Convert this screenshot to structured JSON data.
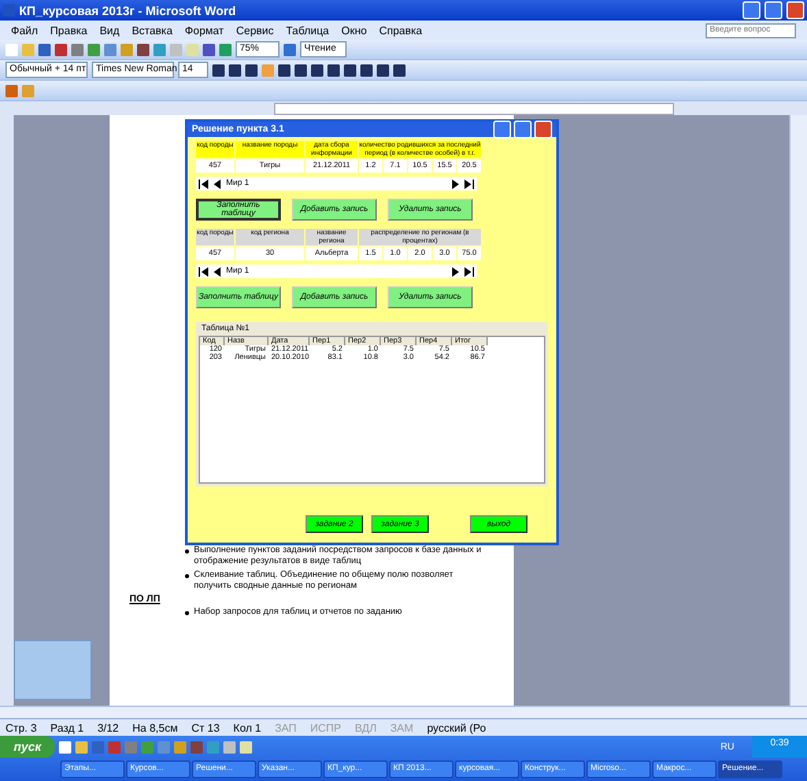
{
  "window": {
    "title": "КП_курсовая 2013г - Microsoft Word"
  },
  "menu": [
    "Файл",
    "Правка",
    "Вид",
    "Вставка",
    "Формат",
    "Сервис",
    "Таблица",
    "Окно",
    "Справка"
  ],
  "help_search": {
    "placeholder": "Введите вопрос"
  },
  "toolbar": {
    "zoom": "75%",
    "reading": "Чтение",
    "style": "Обычный + 14 пт",
    "font": "Times New Roman",
    "size": "14"
  },
  "dialog": {
    "title": "Решение пункта 3.1",
    "section1": {
      "labels": [
        "код породы",
        "название породы",
        "дата сбора информации",
        "количество родившихся за последний период (в количестве особей) в т.г."
      ],
      "values": [
        "457",
        "Тигры",
        "21.12.2011",
        "1.2",
        "7.1",
        "10.5",
        "15.5",
        "20.5"
      ],
      "record": "Мир 1",
      "buttons": [
        {
          "label": "Заполнить таблицу",
          "focused": true
        },
        {
          "label": "Добавить запись",
          "focused": false
        },
        {
          "label": "Удалить запись",
          "focused": false
        }
      ]
    },
    "section2": {
      "labels": [
        "код породы",
        "код региона",
        "название региона",
        "распределение по регионам (в процентах)"
      ],
      "values": [
        "457",
        "30",
        "Альберта",
        "1.5",
        "1.0",
        "2.0",
        "3.0",
        "75.0"
      ],
      "record": "Мир 1",
      "buttons": [
        {
          "label": "Заполнить таблицу",
          "focused": false
        },
        {
          "label": "Добавить запись",
          "focused": false
        },
        {
          "label": "Удалить запись",
          "focused": false
        }
      ]
    },
    "table": {
      "title": "Таблица №1",
      "columns": [
        "Код",
        "Назв",
        "Дата",
        "Пер1",
        "Пер2",
        "Пер3",
        "Пер4",
        "Итог"
      ],
      "rows": [
        [
          "120",
          "Тигры",
          "21.12.2011",
          "5.2",
          "1.0",
          "7.5",
          "7.5",
          "10.5"
        ],
        [
          "203",
          "Ленивцы",
          "20.10.2010",
          "83.1",
          "10.8",
          "3.0",
          "54.2",
          "86.7"
        ]
      ]
    },
    "footer_buttons": [
      "задание 2",
      "задание 3",
      "выход"
    ]
  },
  "document": {
    "bullets": [
      "Выполнение пунктов заданий посредством запросов к базе данных и отображение результатов в виде таблиц",
      "Склеивание таблиц. Объединение по общему полю позволяет получить сводные данные по регионам"
    ],
    "heading": "ПО ЛП",
    "bullets2": [
      "Набор запросов для таблиц и отчетов по заданию"
    ]
  },
  "status_bar": [
    "Стр. 3",
    "Разд 1",
    "3/12",
    "На 8,5см",
    "Ст 13",
    "Кол 1",
    "ЗАП",
    "ИСПР",
    "ВДЛ",
    "ЗАМ",
    "русский (Ро"
  ],
  "taskbar": {
    "start": "пуск",
    "language": "RU",
    "time": "0:39",
    "tasks": [
      {
        "label": "Этапы...",
        "selected": false
      },
      {
        "label": "Курсов...",
        "selected": false
      },
      {
        "label": "Решени...",
        "selected": false
      },
      {
        "label": "Указан...",
        "selected": false
      },
      {
        "label": "КП_кур...",
        "selected": false
      },
      {
        "label": "КП 2013...",
        "selected": false
      },
      {
        "label": "курсовая...",
        "selected": false
      },
      {
        "label": "Конструк...",
        "selected": false
      },
      {
        "label": "Microso...",
        "selected": false
      },
      {
        "label": "Макрос...",
        "selected": false
      },
      {
        "label": "Решение...",
        "selected": true
      }
    ]
  }
}
